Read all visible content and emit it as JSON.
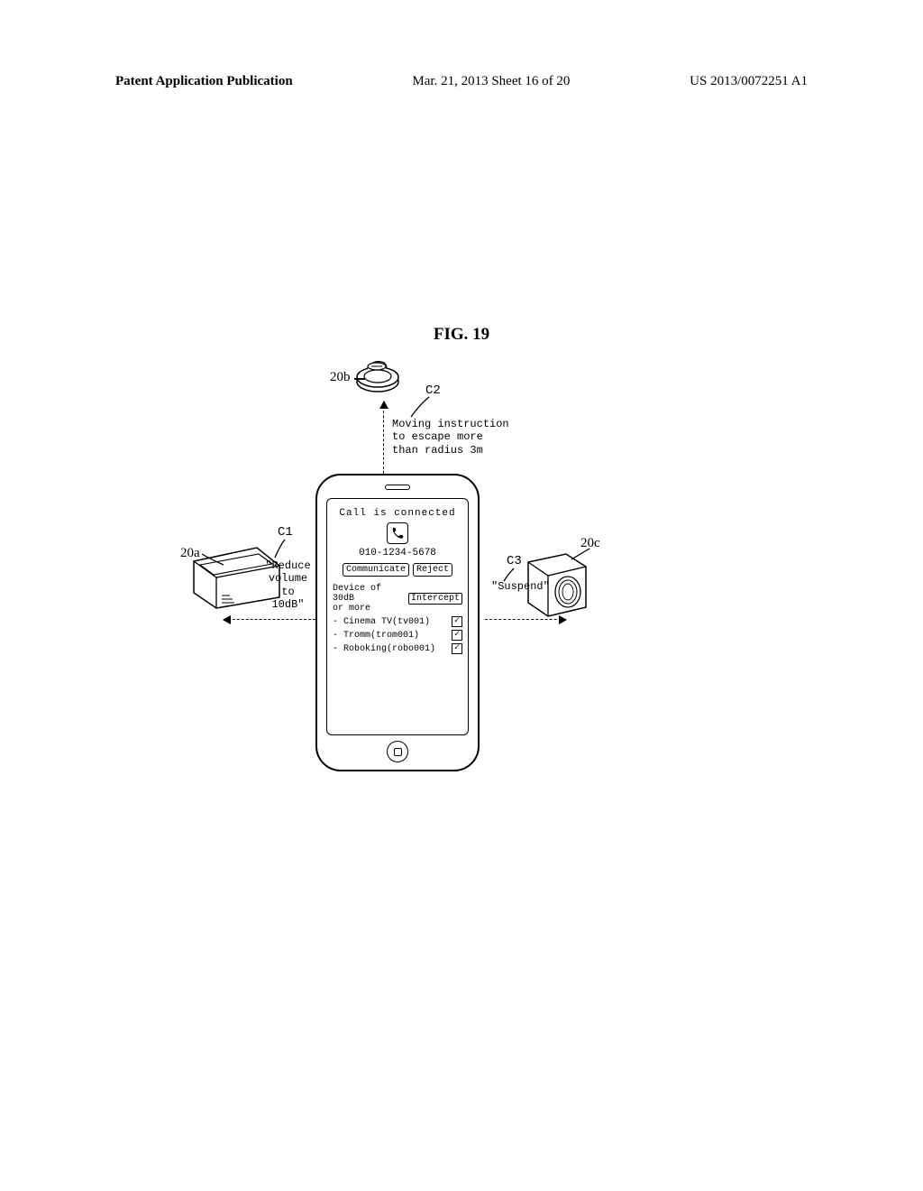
{
  "header": {
    "left": "Patent Application Publication",
    "mid": "Mar. 21, 2013  Sheet 16 of 20",
    "right": "US 2013/0072251 A1"
  },
  "figure_title": "FIG. 19",
  "labels": {
    "ref_20a": "20a",
    "ref_20b": "20b",
    "ref_20c": "20c",
    "c1": "C1",
    "c2": "C2",
    "c3": "C3"
  },
  "c1_text_line1": "\"Reduce",
  "c1_text_line2": "volume",
  "c1_text_line3": "to 10dB\"",
  "c2_text_line1": "Moving instruction",
  "c2_text_line2": "to escape more",
  "c2_text_line3": "than radius 3m",
  "c3_text": "\"Suspend\"",
  "phone": {
    "call_status": "Call is connected",
    "number": "010-1234-5678",
    "btn_communicate": "Communicate",
    "btn_reject": "Reject",
    "section_label_line1": "Device of 30dB",
    "section_label_line2": "or more",
    "btn_intercept": "Intercept",
    "devices": [
      {
        "name": "- Cinema TV(tv001)",
        "checked": true
      },
      {
        "name": "- Tromm(trom001)",
        "checked": true
      },
      {
        "name": "- Roboking(robo001)",
        "checked": true
      }
    ]
  }
}
